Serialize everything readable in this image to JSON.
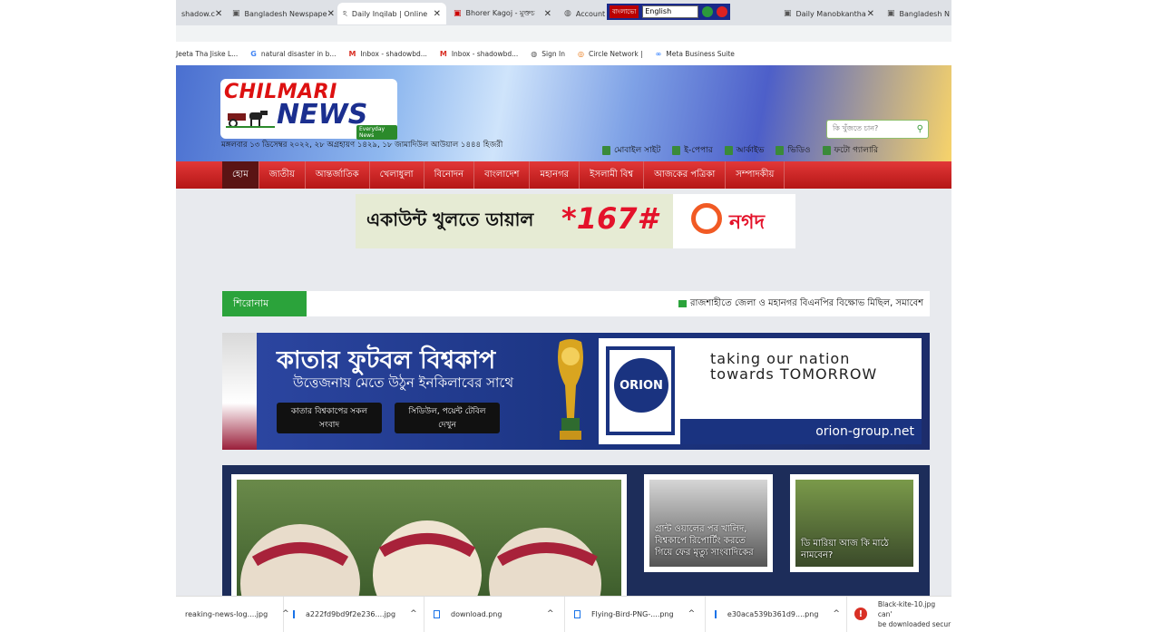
{
  "browser": {
    "tabs": [
      {
        "label": "shadow.c",
        "icon": "site-icon"
      },
      {
        "label": "Bangladesh Newspape",
        "icon": "site-icon"
      },
      {
        "label": "Daily Inqilab | Online",
        "icon": "inqilab-icon",
        "active": true
      },
      {
        "label": "Bhorer Kagoj - মুক্তচ",
        "icon": "bhorer-kagoj-icon"
      },
      {
        "label": "Account",
        "icon": "globe-icon"
      },
      {
        "label": "Daily Manobkantha",
        "icon": "site-icon"
      },
      {
        "label": "Bangladesh N",
        "icon": "site-icon"
      }
    ],
    "language": {
      "label": "বাংলাভো",
      "selected": "English"
    },
    "bookmarks": [
      {
        "label": "Jeeta Tha Jiske L...",
        "icon": "site-icon"
      },
      {
        "label": "natural disaster in b...",
        "icon": "google-icon"
      },
      {
        "label": "Inbox - shadowbd...",
        "icon": "gmail-icon"
      },
      {
        "label": "Inbox - shadowbd...",
        "icon": "gmail-icon"
      },
      {
        "label": "Sign In",
        "icon": "globe-icon"
      },
      {
        "label": "Circle Network |",
        "icon": "circle-icon"
      },
      {
        "label": "Meta Business Suite",
        "icon": "meta-icon"
      }
    ]
  },
  "site": {
    "logo": {
      "line1": "CHILMARI",
      "line2": "NEWS",
      "tagline": "Everyday News"
    },
    "date": "মঙ্গলবার ১৩ ডিসেম্বর ২০২২, ২৮ অগ্রহায়ণ ১৪২৯, ১৮ জামাদিউল আউয়াল ১৪৪৪ হিজরী",
    "search_placeholder": "কি খুঁজতে চান?",
    "toplinks": [
      "মোবাইল সাইট",
      "ই-পেপার",
      "আর্কাইভ",
      "ভিডিও",
      "ফটো গ্যালারি"
    ],
    "nav": [
      "হোম",
      "জাতীয়",
      "আন্তর্জাতিক",
      "খেলাধুলা",
      "বিনোদন",
      "বাংলাদেশ",
      "মহানগর",
      "ইসলামী বিশ্ব",
      "আজকের পত্রিকা",
      "সম্পাদকীয়"
    ],
    "ad": {
      "text": "একাউন্ট খুলতে ডায়াল",
      "code": "*167#",
      "brand": "নগদ"
    },
    "headline": {
      "label": "শিরোনাম",
      "text": "রাজশাহীতে জেলা ও মহানগর বিএনপির বিক্ষোভ মিছিল, সমাবেশ"
    },
    "worldcup": {
      "title": "কাতার ফুটবল বিশ্বকাপ",
      "subtitle": "উত্তেজনায় মেতে উঠুন ইনকিলাবের সাথে",
      "button1": "কাতার বিশ্বকাপের সকল সংবাদ",
      "button2": "সিডিউল, পয়েন্ট টেবিল দেখুন"
    },
    "orion": {
      "logo": "ORION",
      "slogan": "taking our nation towards TOMORROW",
      "url": "orion-group.net"
    },
    "news": [
      {
        "caption": "গ্রান্ট ওয়ালের পর খালিদ, বিশ্বকাপে রিপোর্টিং করতে গিয়ে ফের মৃত্যু সাংবাদিকের"
      },
      {
        "caption": "ডি মারিয়া আজ কি মাঠে নামবেন?"
      }
    ]
  },
  "downloads": [
    {
      "name": "reaking-news-log....jpg"
    },
    {
      "name": "a222fd9bd9f2e236....jpg"
    },
    {
      "name": "download.png"
    },
    {
      "name": "Flying-Bird-PNG-....png"
    },
    {
      "name": "e30aca539b361d9....png"
    }
  ],
  "download_error": {
    "line1": "Black-kite-10.jpg can'",
    "line2": "be downloaded secur"
  }
}
